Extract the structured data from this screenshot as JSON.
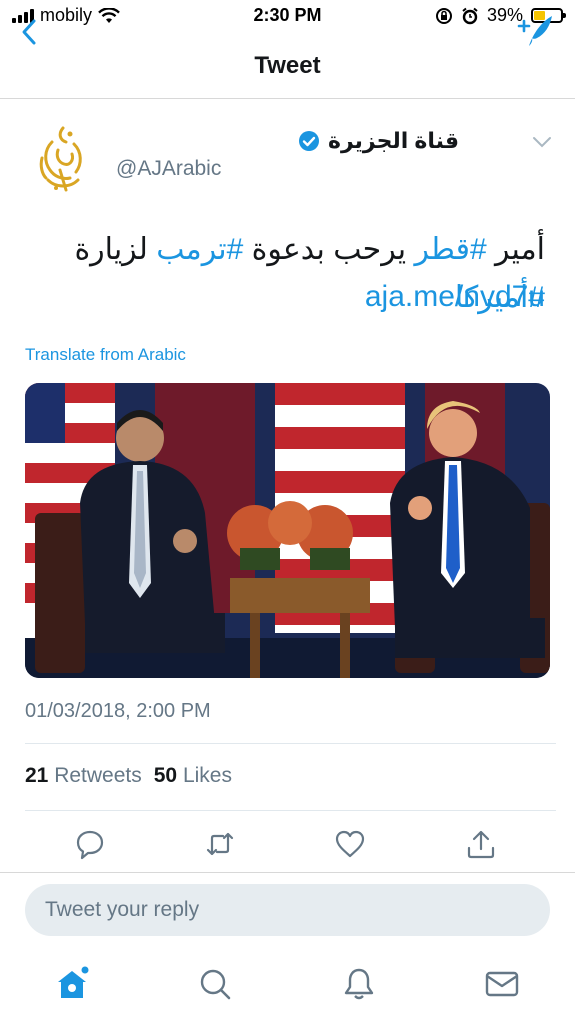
{
  "status_bar": {
    "carrier": "mobily",
    "time": "2:30 PM",
    "battery_percent": "39%",
    "battery_level": 0.39,
    "battery_color": "#f5c400",
    "icons": [
      "signal-bars-icon",
      "wifi-icon",
      "rotation-lock-icon",
      "alarm-icon",
      "battery-icon"
    ]
  },
  "nav": {
    "title": "Tweet",
    "back_icon": "back-chevron-icon",
    "compose_icon": "compose-tweet-icon"
  },
  "tweet": {
    "author_name": "قناة الجزيرة",
    "verified": true,
    "handle": "@AJArabic",
    "text_parts": [
      {
        "text": "أمير ",
        "hashtag": false
      },
      {
        "text": "#قطر",
        "hashtag": true
      },
      {
        "text": " يرحب بدعوة ",
        "hashtag": false
      },
      {
        "text": "#ترمب",
        "hashtag": true
      },
      {
        "text": " لزيارة ",
        "hashtag": false
      },
      {
        "text": "#أميركا",
        "hashtag": true
      }
    ],
    "link": "aja.me/nvd7u",
    "translate_label": "Translate from Arabic",
    "timestamp": "01/03/2018, 2:00 PM",
    "retweets_count": "21",
    "retweets_label": "Retweets",
    "likes_count": "50",
    "likes_label": "Likes"
  },
  "actions": [
    "reply-icon",
    "retweet-icon",
    "like-icon",
    "share-icon"
  ],
  "reply": {
    "placeholder": "Tweet your reply"
  },
  "tab_bar": [
    "home-icon",
    "search-icon",
    "notifications-icon",
    "messages-icon"
  ],
  "colors": {
    "accent": "#1b95e0",
    "secondary_text": "#657786",
    "divider": "#e1e8ed"
  }
}
